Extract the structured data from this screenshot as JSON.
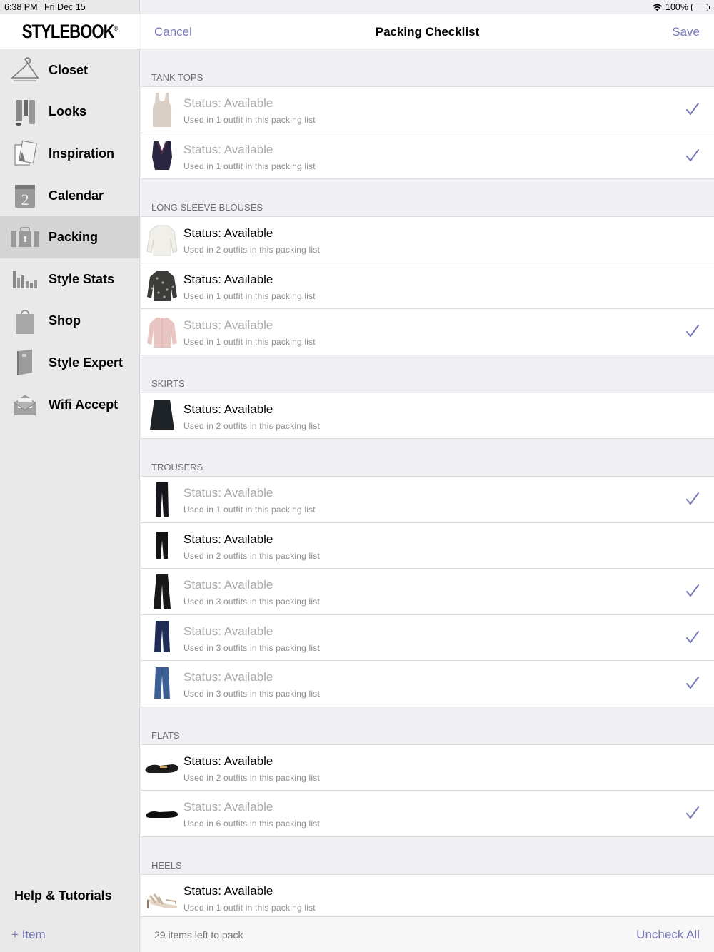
{
  "status_bar": {
    "time": "6:38 PM",
    "date": "Fri Dec 15",
    "battery": "100%"
  },
  "sidebar": {
    "logo": "STYLEBOOK",
    "logo_mark": "®",
    "items": [
      {
        "label": "Closet",
        "icon": "hanger-icon"
      },
      {
        "label": "Looks",
        "icon": "outfit-icon"
      },
      {
        "label": "Inspiration",
        "icon": "photos-icon"
      },
      {
        "label": "Calendar",
        "icon": "calendar-icon"
      },
      {
        "label": "Packing",
        "icon": "suitcase-icon",
        "active": true
      },
      {
        "label": "Style Stats",
        "icon": "bar-chart-icon"
      },
      {
        "label": "Shop",
        "icon": "shopping-bag-icon"
      },
      {
        "label": "Style Expert",
        "icon": "book-icon"
      },
      {
        "label": "Wifi Accept",
        "icon": "envelope-icon"
      }
    ],
    "help": "Help & Tutorials",
    "add_item": "+ Item"
  },
  "navbar": {
    "cancel": "Cancel",
    "title": "Packing Checklist",
    "save": "Save"
  },
  "sections": [
    {
      "header": "TANK TOPS",
      "rows": [
        {
          "title": "Status: Available",
          "sub": "Used in 1 outfit in this packing list",
          "checked": true,
          "thumb": "tank-top-beige"
        },
        {
          "title": "Status: Available",
          "sub": "Used in 1 outfit in this packing list",
          "checked": true,
          "thumb": "tank-top-navy"
        }
      ]
    },
    {
      "header": "LONG SLEEVE BLOUSES",
      "rows": [
        {
          "title": "Status: Available",
          "sub": "Used in 2 outfits in this packing list",
          "checked": false,
          "thumb": "blouse-white"
        },
        {
          "title": "Status: Available",
          "sub": "Used in 1 outfit in this packing list",
          "checked": false,
          "thumb": "blouse-print"
        },
        {
          "title": "Status: Available",
          "sub": "Used in 1 outfit in this packing list",
          "checked": true,
          "thumb": "blouse-pink"
        }
      ]
    },
    {
      "header": "SKIRTS",
      "rows": [
        {
          "title": "Status: Available",
          "sub": "Used in 2 outfits in this packing list",
          "checked": false,
          "thumb": "skirt-black"
        }
      ]
    },
    {
      "header": "TROUSERS",
      "rows": [
        {
          "title": "Status: Available",
          "sub": "Used in 1 outfit in this packing list",
          "checked": true,
          "thumb": "trousers-black"
        },
        {
          "title": "Status: Available",
          "sub": "Used in 2 outfits in this packing list",
          "checked": false,
          "thumb": "trousers-black-cropped"
        },
        {
          "title": "Status: Available",
          "sub": "Used in 3 outfits in this packing list",
          "checked": true,
          "thumb": "trousers-wide-black"
        },
        {
          "title": "Status: Available",
          "sub": "Used in 3 outfits in this packing list",
          "checked": true,
          "thumb": "trousers-navy"
        },
        {
          "title": "Status: Available",
          "sub": "Used in 3 outfits in this packing list",
          "checked": true,
          "thumb": "jeans-blue"
        }
      ]
    },
    {
      "header": "FLATS",
      "rows": [
        {
          "title": "Status: Available",
          "sub": "Used in 2 outfits in this packing list",
          "checked": false,
          "thumb": "loafer-black"
        },
        {
          "title": "Status: Available",
          "sub": "Used in 6 outfits in this packing list",
          "checked": true,
          "thumb": "ballet-flat-black"
        }
      ]
    },
    {
      "header": "HEELS",
      "rows": [
        {
          "title": "Status: Available",
          "sub": "Used in 1 outfit in this packing list",
          "checked": false,
          "thumb": "sandal-heel"
        }
      ]
    }
  ],
  "footer": {
    "left": "29 items left to pack",
    "right": "Uncheck All"
  },
  "colors": {
    "accent": "#7678b8",
    "checked_text": "#a9a9ad"
  }
}
